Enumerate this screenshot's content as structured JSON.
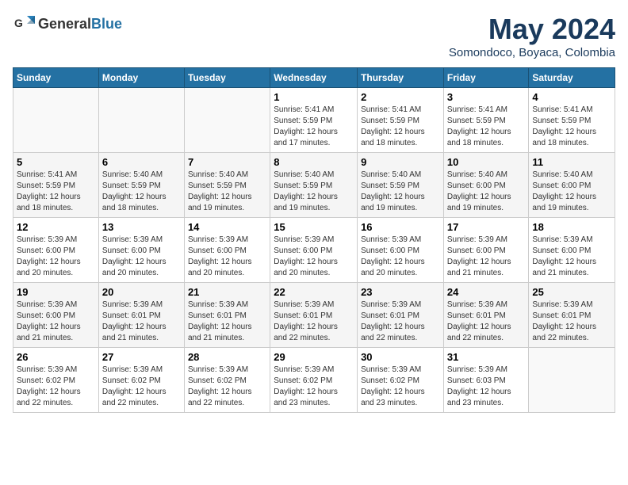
{
  "header": {
    "logo_general": "General",
    "logo_blue": "Blue",
    "title": "May 2024",
    "location": "Somondoco, Boyaca, Colombia"
  },
  "weekdays": [
    "Sunday",
    "Monday",
    "Tuesday",
    "Wednesday",
    "Thursday",
    "Friday",
    "Saturday"
  ],
  "weeks": [
    [
      {
        "day": "",
        "info": ""
      },
      {
        "day": "",
        "info": ""
      },
      {
        "day": "",
        "info": ""
      },
      {
        "day": "1",
        "info": "Sunrise: 5:41 AM\nSunset: 5:59 PM\nDaylight: 12 hours\nand 17 minutes."
      },
      {
        "day": "2",
        "info": "Sunrise: 5:41 AM\nSunset: 5:59 PM\nDaylight: 12 hours\nand 18 minutes."
      },
      {
        "day": "3",
        "info": "Sunrise: 5:41 AM\nSunset: 5:59 PM\nDaylight: 12 hours\nand 18 minutes."
      },
      {
        "day": "4",
        "info": "Sunrise: 5:41 AM\nSunset: 5:59 PM\nDaylight: 12 hours\nand 18 minutes."
      }
    ],
    [
      {
        "day": "5",
        "info": "Sunrise: 5:41 AM\nSunset: 5:59 PM\nDaylight: 12 hours\nand 18 minutes."
      },
      {
        "day": "6",
        "info": "Sunrise: 5:40 AM\nSunset: 5:59 PM\nDaylight: 12 hours\nand 18 minutes."
      },
      {
        "day": "7",
        "info": "Sunrise: 5:40 AM\nSunset: 5:59 PM\nDaylight: 12 hours\nand 19 minutes."
      },
      {
        "day": "8",
        "info": "Sunrise: 5:40 AM\nSunset: 5:59 PM\nDaylight: 12 hours\nand 19 minutes."
      },
      {
        "day": "9",
        "info": "Sunrise: 5:40 AM\nSunset: 5:59 PM\nDaylight: 12 hours\nand 19 minutes."
      },
      {
        "day": "10",
        "info": "Sunrise: 5:40 AM\nSunset: 6:00 PM\nDaylight: 12 hours\nand 19 minutes."
      },
      {
        "day": "11",
        "info": "Sunrise: 5:40 AM\nSunset: 6:00 PM\nDaylight: 12 hours\nand 19 minutes."
      }
    ],
    [
      {
        "day": "12",
        "info": "Sunrise: 5:39 AM\nSunset: 6:00 PM\nDaylight: 12 hours\nand 20 minutes."
      },
      {
        "day": "13",
        "info": "Sunrise: 5:39 AM\nSunset: 6:00 PM\nDaylight: 12 hours\nand 20 minutes."
      },
      {
        "day": "14",
        "info": "Sunrise: 5:39 AM\nSunset: 6:00 PM\nDaylight: 12 hours\nand 20 minutes."
      },
      {
        "day": "15",
        "info": "Sunrise: 5:39 AM\nSunset: 6:00 PM\nDaylight: 12 hours\nand 20 minutes."
      },
      {
        "day": "16",
        "info": "Sunrise: 5:39 AM\nSunset: 6:00 PM\nDaylight: 12 hours\nand 20 minutes."
      },
      {
        "day": "17",
        "info": "Sunrise: 5:39 AM\nSunset: 6:00 PM\nDaylight: 12 hours\nand 21 minutes."
      },
      {
        "day": "18",
        "info": "Sunrise: 5:39 AM\nSunset: 6:00 PM\nDaylight: 12 hours\nand 21 minutes."
      }
    ],
    [
      {
        "day": "19",
        "info": "Sunrise: 5:39 AM\nSunset: 6:00 PM\nDaylight: 12 hours\nand 21 minutes."
      },
      {
        "day": "20",
        "info": "Sunrise: 5:39 AM\nSunset: 6:01 PM\nDaylight: 12 hours\nand 21 minutes."
      },
      {
        "day": "21",
        "info": "Sunrise: 5:39 AM\nSunset: 6:01 PM\nDaylight: 12 hours\nand 21 minutes."
      },
      {
        "day": "22",
        "info": "Sunrise: 5:39 AM\nSunset: 6:01 PM\nDaylight: 12 hours\nand 22 minutes."
      },
      {
        "day": "23",
        "info": "Sunrise: 5:39 AM\nSunset: 6:01 PM\nDaylight: 12 hours\nand 22 minutes."
      },
      {
        "day": "24",
        "info": "Sunrise: 5:39 AM\nSunset: 6:01 PM\nDaylight: 12 hours\nand 22 minutes."
      },
      {
        "day": "25",
        "info": "Sunrise: 5:39 AM\nSunset: 6:01 PM\nDaylight: 12 hours\nand 22 minutes."
      }
    ],
    [
      {
        "day": "26",
        "info": "Sunrise: 5:39 AM\nSunset: 6:02 PM\nDaylight: 12 hours\nand 22 minutes."
      },
      {
        "day": "27",
        "info": "Sunrise: 5:39 AM\nSunset: 6:02 PM\nDaylight: 12 hours\nand 22 minutes."
      },
      {
        "day": "28",
        "info": "Sunrise: 5:39 AM\nSunset: 6:02 PM\nDaylight: 12 hours\nand 22 minutes."
      },
      {
        "day": "29",
        "info": "Sunrise: 5:39 AM\nSunset: 6:02 PM\nDaylight: 12 hours\nand 23 minutes."
      },
      {
        "day": "30",
        "info": "Sunrise: 5:39 AM\nSunset: 6:02 PM\nDaylight: 12 hours\nand 23 minutes."
      },
      {
        "day": "31",
        "info": "Sunrise: 5:39 AM\nSunset: 6:03 PM\nDaylight: 12 hours\nand 23 minutes."
      },
      {
        "day": "",
        "info": ""
      }
    ]
  ]
}
